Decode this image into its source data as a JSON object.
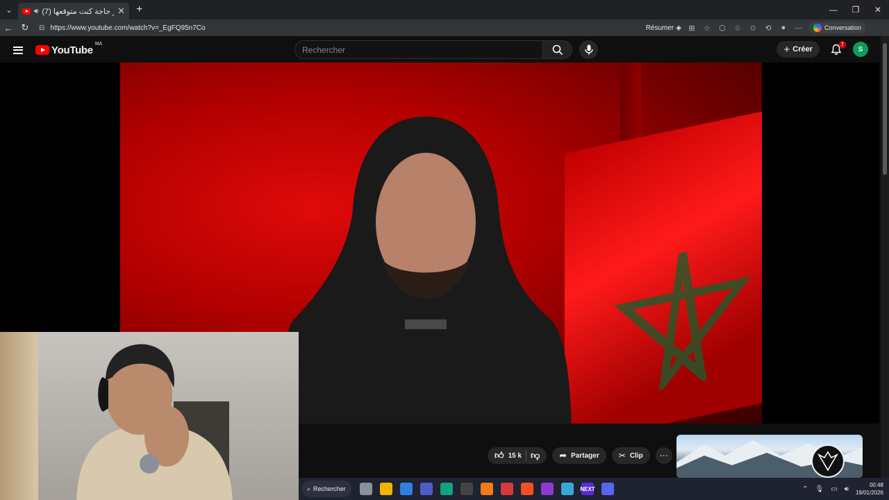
{
  "browser": {
    "tab_title": "(7) أخر حاجة كنت متوقعها - YouTube",
    "url": "https://www.youtube.com/watch?v=_EgFQ95n7Co",
    "resume_label": "Résumer",
    "copilot_label": "Conversation"
  },
  "youtube": {
    "logo_text": "YouTube",
    "country_code": "MA",
    "search_placeholder": "Rechercher",
    "create_label": "Créer",
    "notification_count": "7",
    "avatar_letter": "S"
  },
  "video": {
    "like_count": "15 k",
    "share_label": "Partager",
    "clip_label": "Clip"
  },
  "taskbar": {
    "search_label": "Rechercher",
    "apps": [
      {
        "icon": "task-view-icon",
        "color": "#8a8f9c",
        "text": ""
      },
      {
        "icon": "file-explorer-icon",
        "color": "#f2b400",
        "text": ""
      },
      {
        "icon": "store-icon",
        "color": "#2f7fe0",
        "text": ""
      },
      {
        "icon": "app-icon",
        "color": "#4e5cc7",
        "text": ""
      },
      {
        "icon": "edge-icon",
        "color": "#0fa37f",
        "text": ""
      },
      {
        "icon": "chrome-icon",
        "color": "#444",
        "text": ""
      },
      {
        "icon": "aimp-icon",
        "color": "#f07b17",
        "text": ""
      },
      {
        "icon": "office-icon",
        "color": "#d33a3a",
        "text": ""
      },
      {
        "icon": "brave-icon",
        "color": "#f25022",
        "text": ""
      },
      {
        "icon": "brave-nightly-icon",
        "color": "#8d3ad3",
        "text": ""
      },
      {
        "icon": "window-icon",
        "color": "#3aa6d3",
        "text": ""
      },
      {
        "icon": "next-icon",
        "color": "#5a2bd8",
        "text": "NEXT"
      },
      {
        "icon": "discord-icon",
        "color": "#5865f2",
        "text": ""
      }
    ],
    "time": "00:48",
    "date": "19/01/2026"
  },
  "colors": {
    "brand_red": "#ff0000",
    "badge_red": "#cc0000",
    "avatar_green": "#0d9a5a"
  }
}
